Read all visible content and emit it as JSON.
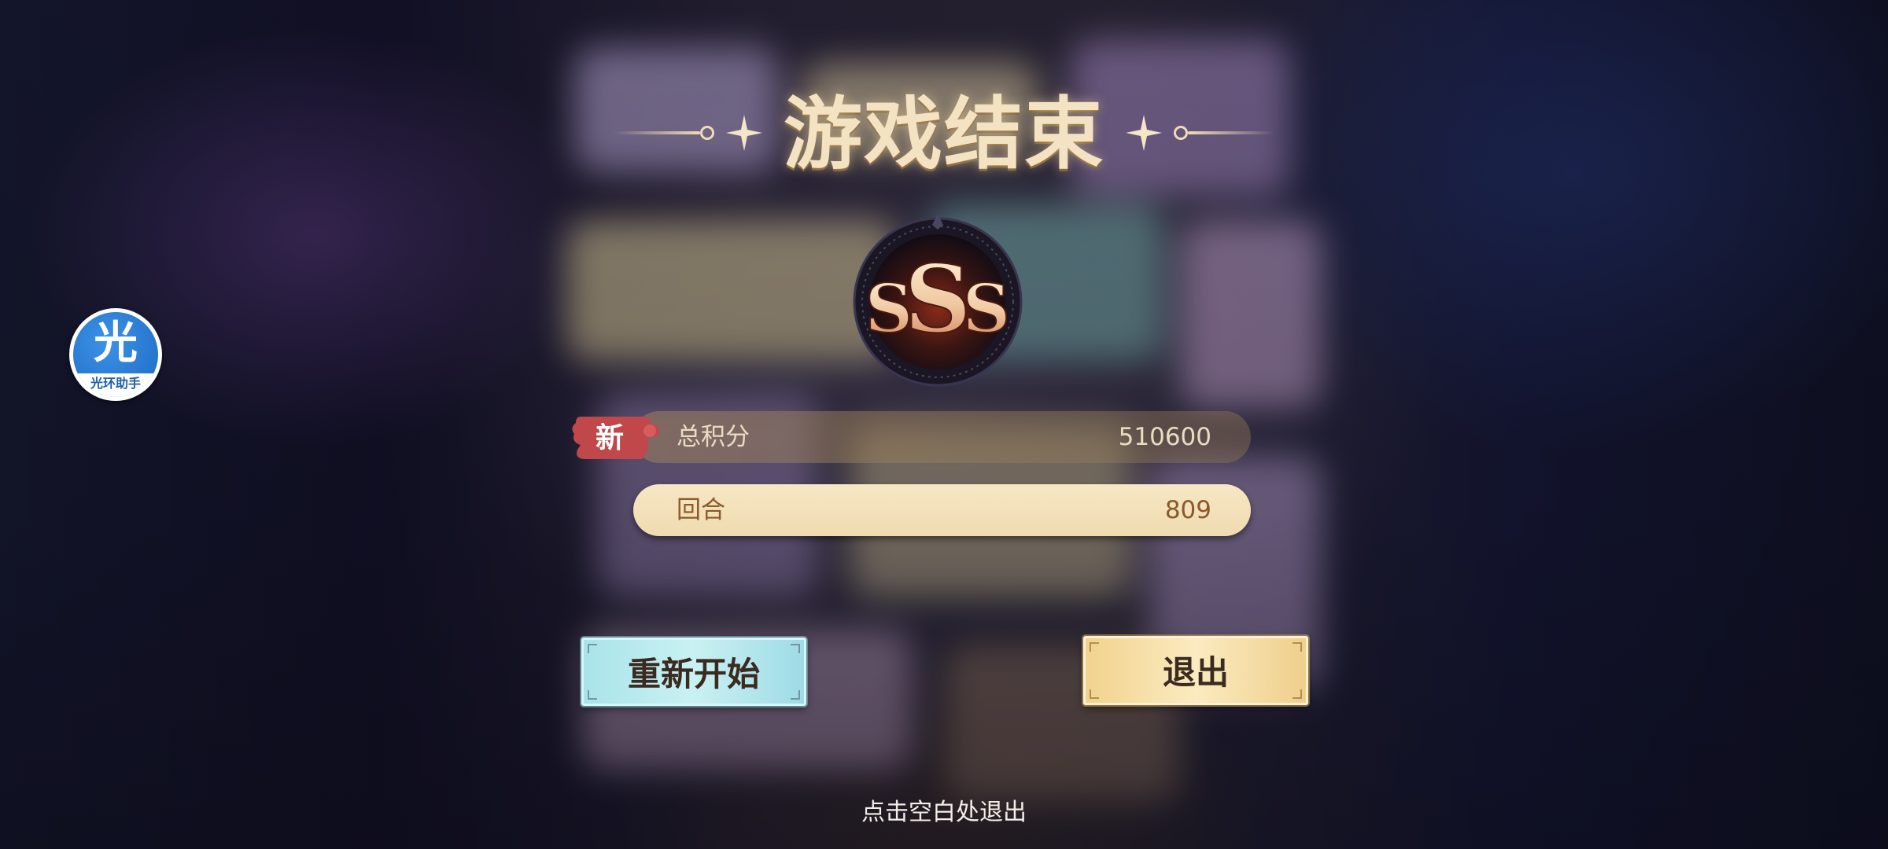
{
  "title": "游戏结束",
  "rank": {
    "grade": "SSS",
    "left": "S",
    "center": "S",
    "right": "S"
  },
  "total_score": {
    "new_badge": "新",
    "label": "总积分",
    "value": "510600"
  },
  "rounds": {
    "label": "回合",
    "value": "809"
  },
  "buttons": {
    "restart": "重新开始",
    "exit": "退出"
  },
  "hint": "点击空白处退出",
  "assistant": {
    "glyph": "光",
    "label": "光环助手"
  },
  "colors": {
    "title": "#f3e3c3",
    "restart_button": "#bfeef0",
    "exit_button": "#f6dfa6",
    "new_badge": "#c0484a",
    "rounds_bar": "#f3e1b8",
    "assistant": "#2a7fd6"
  }
}
